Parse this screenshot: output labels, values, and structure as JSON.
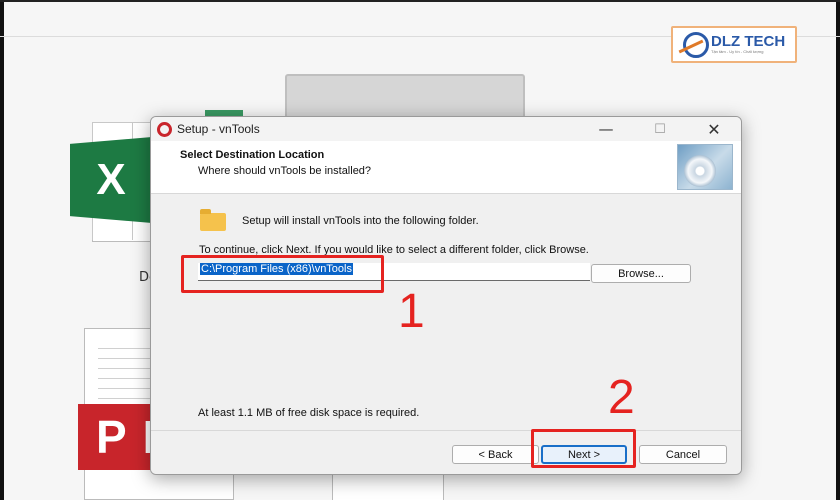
{
  "background": {
    "excel_letter": "X",
    "doc_label": "De",
    "pdf_letters": "PD"
  },
  "logo": {
    "text": "DLZ TECH",
    "tagline": "Tận tâm - Uy tín - Chất lượng"
  },
  "dialog": {
    "title": "Setup - vnTools",
    "controls": {
      "minimize": "—",
      "maximize": "☐",
      "close": "✕"
    },
    "header": {
      "title": "Select Destination Location",
      "subtitle": "Where should vnTools be installed?"
    },
    "install_message": "Setup will install vnTools into the following folder.",
    "continue_message": "To continue, click Next. If you would like to select a different folder, click Browse.",
    "path_value": "C:\\Program Files (x86)\\vnTools",
    "browse_label": "Browse...",
    "disk_space_message": "At least 1.1 MB of free disk space is required.",
    "buttons": {
      "back": "< Back",
      "next": "Next >",
      "cancel": "Cancel"
    }
  },
  "annotations": {
    "step1": "1",
    "step2": "2",
    "color": "#e52320"
  },
  "colors": {
    "selection": "#0a64c8",
    "excel_green": "#1d7a43",
    "pdf_red": "#c8252b",
    "logo_blue": "#2b5aa8"
  }
}
